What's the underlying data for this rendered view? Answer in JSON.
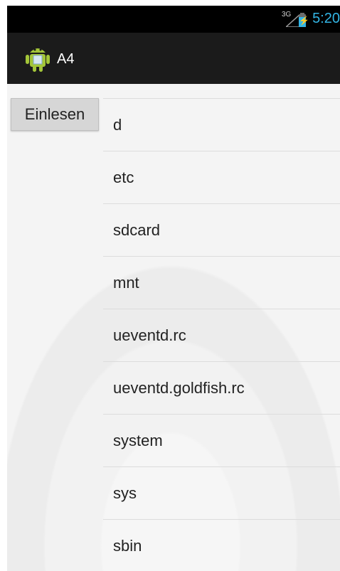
{
  "status_bar": {
    "network": "3G",
    "time": "5:20",
    "colors": {
      "accent": "#33b5e5"
    }
  },
  "action_bar": {
    "app_icon": "android-icon",
    "title": "A4"
  },
  "main": {
    "read_button_label": "Einlesen",
    "files": [
      "d",
      "etc",
      "sdcard",
      "mnt",
      "ueventd.rc",
      "ueventd.goldfish.rc",
      "system",
      "sys",
      "sbin"
    ]
  }
}
